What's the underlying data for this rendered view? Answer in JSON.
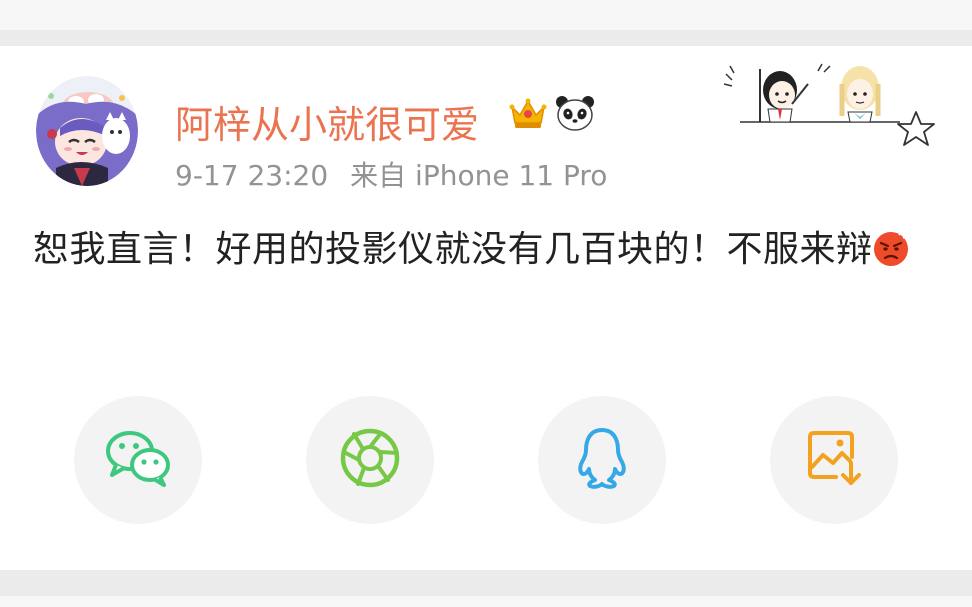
{
  "post": {
    "username": "阿梓从小就很可爱",
    "time": "9-17 23:20",
    "source": "来自 iPhone 11 Pro",
    "text": "恕我直言！好用的投影仪就没有几百块的！不服来辩"
  },
  "badges": [
    "crown-icon",
    "panda-icon"
  ],
  "share": {
    "buttons": [
      "wechat-icon",
      "moments-icon",
      "qq-icon",
      "save-image-icon"
    ]
  },
  "colors": {
    "username": "#eb7350",
    "meta": "#939393",
    "wechat": "#3ec77f",
    "moments": "#77c846",
    "qq": "#35a8e8",
    "save": "#f3a21f"
  }
}
